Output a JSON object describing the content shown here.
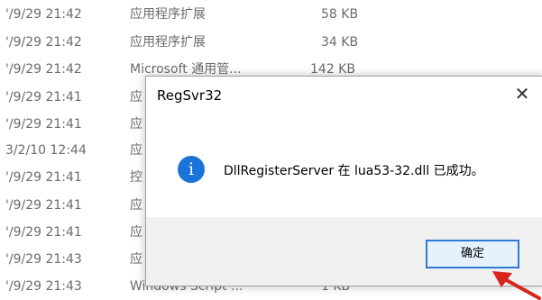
{
  "files": [
    {
      "date": "'/9/29 21:42",
      "type": "应用程序扩展",
      "size": "58 KB"
    },
    {
      "date": "'/9/29 21:42",
      "type": "应用程序扩展",
      "size": "34 KB"
    },
    {
      "date": "'/9/29 21:42",
      "type": "Microsoft 通用管...",
      "size": "142 KB"
    },
    {
      "date": "'/9/29 21:41",
      "type": "应",
      "size": ""
    },
    {
      "date": "'/9/29 21:41",
      "type": "应",
      "size": ""
    },
    {
      "date": "3/2/10 12:44",
      "type": "应",
      "size": ""
    },
    {
      "date": "'/9/29 21:41",
      "type": "控",
      "size": ""
    },
    {
      "date": "'/9/29 21:41",
      "type": "应",
      "size": ""
    },
    {
      "date": "'/9/29 21:41",
      "type": "应",
      "size": ""
    },
    {
      "date": "'/9/29 21:43",
      "type": "应",
      "size": ""
    },
    {
      "date": "'/9/29 21:43",
      "type": "Windows Script ...",
      "size": "1 KB"
    }
  ],
  "dialog": {
    "title": "RegSvr32",
    "close_glyph": "✕",
    "icon_glyph": "i",
    "message": "DllRegisterServer 在 lua53-32.dll 已成功。",
    "ok_label": "确定"
  },
  "colors": {
    "accent": "#2f7ad6",
    "info_icon": "#1a73d9",
    "arrow": "#d9241c"
  }
}
